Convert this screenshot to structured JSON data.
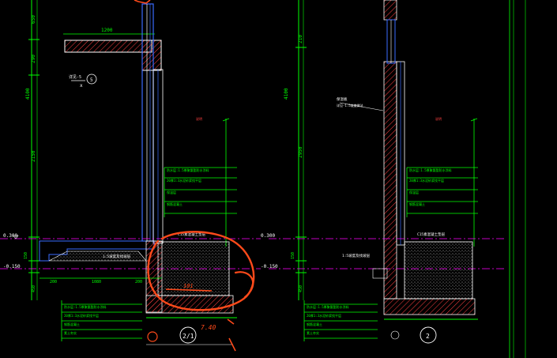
{
  "colors": {
    "background": "#000000",
    "dim": "#00ff00",
    "wall": "#ffffff",
    "hatch": "#ff4040",
    "glass": "#3a6bff",
    "ground": "#ff00ff",
    "annot": "#ff4a1a",
    "leader": "#00ffff"
  },
  "left": {
    "dim_vertical": [
      "650",
      "290",
      "4100",
      "2150",
      "150",
      "450"
    ],
    "dim_top": "1200",
    "dim_bottom": [
      "200",
      "1080",
      "200"
    ],
    "level_plus": "0.300",
    "level_minus": "-0.150",
    "note_label": "1:5坡度及找坡层",
    "slab_callout": "详见-5",
    "slab_mark": "x",
    "detail_id": "2/1",
    "marker_inner": "5",
    "handwritten_a": "101",
    "handwritten_b": "7.40",
    "legend_red": "说明"
  },
  "right": {
    "dim_vertical": [
      "210",
      "4100",
      "2950",
      "150",
      "450"
    ],
    "level_plus": "0.300",
    "level_minus": "-0.150",
    "note_label": "1:5坡度及找坡层",
    "detail_id": "2",
    "callout": "保温板",
    "callout2": "详见-1:5坡度做法",
    "legend_red": "说明",
    "slab_note": "C15素混凝土垫层"
  },
  "left_slab_note": "C15素混凝土垫层",
  "spec_lines": [
    "防水层:1.5厚聚氨酯防水涂料",
    "20厚1:3水泥砂浆找平层",
    "保温层",
    "钢筋混凝土",
    "素土夯实"
  ]
}
